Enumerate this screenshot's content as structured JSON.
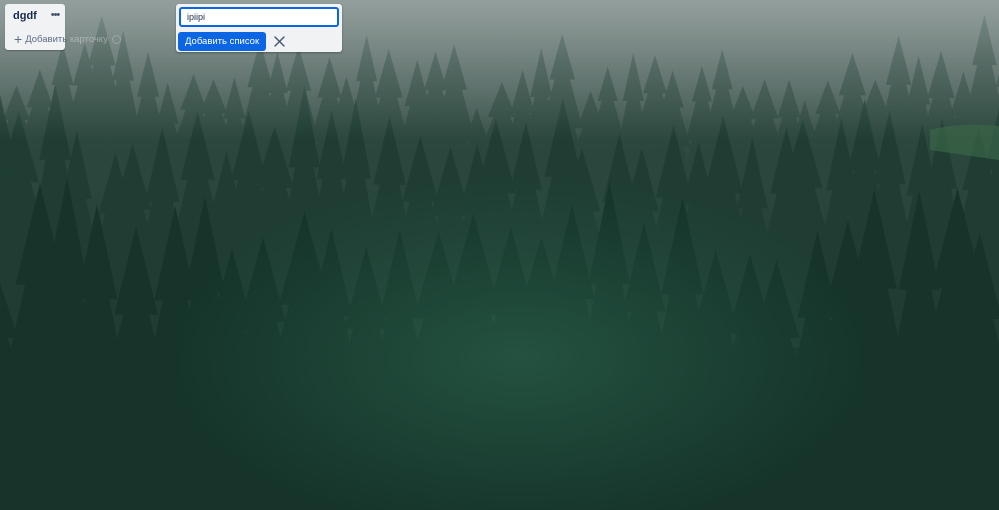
{
  "board": {
    "background_colors": [
      "#6f7d7a",
      "#2f4d43",
      "#1a3a30",
      "#0f2a22"
    ]
  },
  "list": {
    "title": "dgdf",
    "menu_icon": "ellipsis-icon",
    "add_card_label_visible": "Добавить ",
    "add_card_label_overflow": "карточку",
    "add_card_icon": "plus-icon",
    "template_icon": "template-icon"
  },
  "composer": {
    "input_value": "ipiipi",
    "add_button_label": "Добавить список",
    "close_icon": "close-icon",
    "accent_color": "#0c66e4"
  }
}
